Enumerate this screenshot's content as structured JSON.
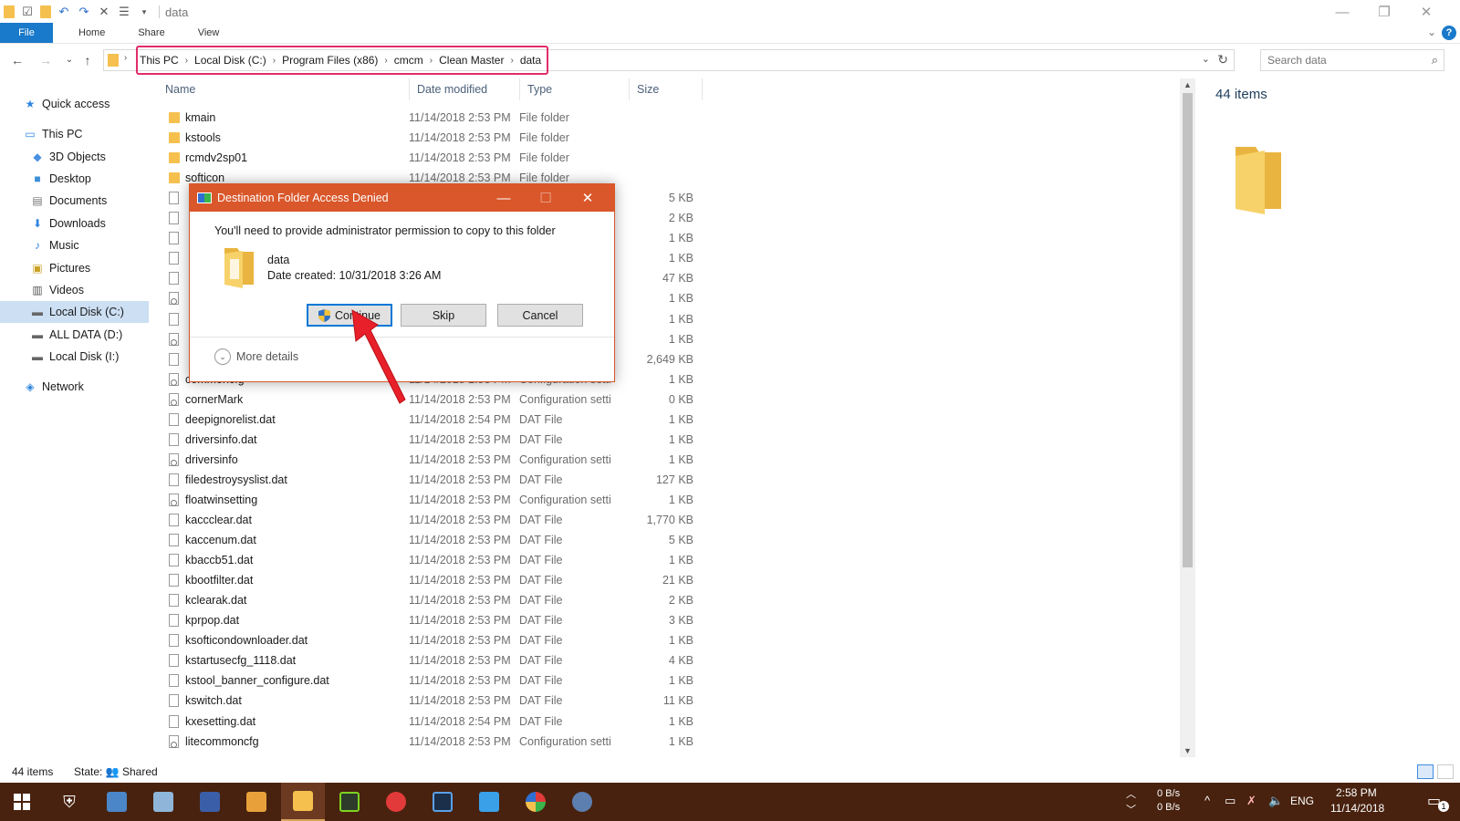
{
  "window": {
    "title": "data",
    "minimize_glyph": "—",
    "maximize_glyph": "❐",
    "close_glyph": "✕"
  },
  "ribbon": {
    "tabs": [
      "File",
      "Home",
      "Share",
      "View"
    ]
  },
  "address": {
    "crumbs": [
      "This PC",
      "Local Disk (C:)",
      "Program Files (x86)",
      "cmcm",
      "Clean Master",
      "data"
    ],
    "highlight_color": "#e22c6a"
  },
  "search": {
    "placeholder": "Search data"
  },
  "nav": {
    "items": [
      {
        "label": "Quick access",
        "icon": "star-icon"
      },
      {
        "label": "This PC",
        "icon": "computer-icon"
      },
      {
        "label": "3D Objects",
        "icon": "cube-icon"
      },
      {
        "label": "Desktop",
        "icon": "desktop-icon"
      },
      {
        "label": "Documents",
        "icon": "document-icon"
      },
      {
        "label": "Downloads",
        "icon": "download-icon"
      },
      {
        "label": "Music",
        "icon": "music-icon"
      },
      {
        "label": "Pictures",
        "icon": "picture-icon"
      },
      {
        "label": "Videos",
        "icon": "video-icon"
      },
      {
        "label": "Local Disk (C:)",
        "icon": "drive-icon"
      },
      {
        "label": "ALL DATA (D:)",
        "icon": "drive-icon"
      },
      {
        "label": "Local Disk (I:)",
        "icon": "drive-icon"
      },
      {
        "label": "Network",
        "icon": "network-icon"
      }
    ]
  },
  "columns": {
    "name": "Name",
    "date": "Date modified",
    "type": "Type",
    "size": "Size"
  },
  "files": [
    {
      "name": "kmain",
      "date": "11/14/2018 2:53 PM",
      "type": "File folder",
      "size": "",
      "kind": "folder"
    },
    {
      "name": "kstools",
      "date": "11/14/2018 2:53 PM",
      "type": "File folder",
      "size": "",
      "kind": "folder"
    },
    {
      "name": "rcmdv2sp01",
      "date": "11/14/2018 2:53 PM",
      "type": "File folder",
      "size": "",
      "kind": "folder"
    },
    {
      "name": "softicon",
      "date": "11/14/2018 2:53 PM",
      "type": "File folder",
      "size": "",
      "kind": "folder"
    },
    {
      "name": "",
      "date": "",
      "type": "",
      "size": "5 KB",
      "kind": "file"
    },
    {
      "name": "",
      "date": "",
      "type": "",
      "size": "2 KB",
      "kind": "file"
    },
    {
      "name": "",
      "date": "",
      "type": "",
      "size": "1 KB",
      "kind": "file"
    },
    {
      "name": "",
      "date": "",
      "type": "",
      "size": "1 KB",
      "kind": "file"
    },
    {
      "name": "",
      "date": "",
      "type": "",
      "size": "47 KB",
      "kind": "file"
    },
    {
      "name": "",
      "date": "",
      "type": "",
      "size": "1 KB",
      "kind": "cfg"
    },
    {
      "name": "",
      "date": "",
      "type": "",
      "size": "1 KB",
      "kind": "file"
    },
    {
      "name": "",
      "date": "",
      "type": "",
      "size": "1 KB",
      "kind": "cfg"
    },
    {
      "name": "",
      "date": "",
      "type": "",
      "size": "2,649 KB",
      "kind": "file"
    },
    {
      "name": "commoncfg",
      "date": "11/14/2018 2:53 PM",
      "type": "Configuration setti",
      "size": "1 KB",
      "kind": "cfg"
    },
    {
      "name": "cornerMark",
      "date": "11/14/2018 2:53 PM",
      "type": "Configuration setti",
      "size": "0 KB",
      "kind": "cfg"
    },
    {
      "name": "deepignorelist.dat",
      "date": "11/14/2018 2:54 PM",
      "type": "DAT File",
      "size": "1 KB",
      "kind": "file"
    },
    {
      "name": "driversinfo.dat",
      "date": "11/14/2018 2:53 PM",
      "type": "DAT File",
      "size": "1 KB",
      "kind": "file"
    },
    {
      "name": "driversinfo",
      "date": "11/14/2018 2:53 PM",
      "type": "Configuration setti",
      "size": "1 KB",
      "kind": "cfg"
    },
    {
      "name": "filedestroysyslist.dat",
      "date": "11/14/2018 2:53 PM",
      "type": "DAT File",
      "size": "127 KB",
      "kind": "file"
    },
    {
      "name": "floatwinsetting",
      "date": "11/14/2018 2:53 PM",
      "type": "Configuration setti",
      "size": "1 KB",
      "kind": "cfg"
    },
    {
      "name": "kaccclear.dat",
      "date": "11/14/2018 2:53 PM",
      "type": "DAT File",
      "size": "1,770 KB",
      "kind": "file"
    },
    {
      "name": "kaccenum.dat",
      "date": "11/14/2018 2:53 PM",
      "type": "DAT File",
      "size": "5 KB",
      "kind": "file"
    },
    {
      "name": "kbaccb51.dat",
      "date": "11/14/2018 2:53 PM",
      "type": "DAT File",
      "size": "1 KB",
      "kind": "file"
    },
    {
      "name": "kbootfilter.dat",
      "date": "11/14/2018 2:53 PM",
      "type": "DAT File",
      "size": "21 KB",
      "kind": "file"
    },
    {
      "name": "kclearak.dat",
      "date": "11/14/2018 2:53 PM",
      "type": "DAT File",
      "size": "2 KB",
      "kind": "file"
    },
    {
      "name": "kprpop.dat",
      "date": "11/14/2018 2:53 PM",
      "type": "DAT File",
      "size": "3 KB",
      "kind": "file"
    },
    {
      "name": "ksofticondownloader.dat",
      "date": "11/14/2018 2:53 PM",
      "type": "DAT File",
      "size": "1 KB",
      "kind": "file"
    },
    {
      "name": "kstartusecfg_1118.dat",
      "date": "11/14/2018 2:53 PM",
      "type": "DAT File",
      "size": "4 KB",
      "kind": "file"
    },
    {
      "name": "kstool_banner_configure.dat",
      "date": "11/14/2018 2:53 PM",
      "type": "DAT File",
      "size": "1 KB",
      "kind": "file"
    },
    {
      "name": "kswitch.dat",
      "date": "11/14/2018 2:53 PM",
      "type": "DAT File",
      "size": "11 KB",
      "kind": "file"
    },
    {
      "name": "kxesetting.dat",
      "date": "11/14/2018 2:54 PM",
      "type": "DAT File",
      "size": "1 KB",
      "kind": "file"
    },
    {
      "name": "litecommoncfg",
      "date": "11/14/2018 2:53 PM",
      "type": "Configuration setti",
      "size": "1 KB",
      "kind": "cfg"
    }
  ],
  "details": {
    "count": "44 items"
  },
  "status": {
    "count": "44 items",
    "state": "State:",
    "shared": "Shared"
  },
  "dialog": {
    "title": "Destination Folder Access Denied",
    "message": "You'll need to provide administrator permission to copy to this folder",
    "folder_name": "data",
    "folder_date": "Date created: 10/31/2018 3:26 AM",
    "continue_label": "Continue",
    "skip_label": "Skip",
    "cancel_label": "Cancel",
    "more_details": "More details",
    "title_color": "#d9572a"
  },
  "annotation": {
    "arrow_color": "#e8202a"
  },
  "taskbar": {
    "net_up": "0 B/s",
    "net_down": "0 B/s",
    "lang": "ENG",
    "time": "2:58 PM",
    "date": "11/14/2018",
    "notifications": "1",
    "bg_color": "#48220f"
  }
}
